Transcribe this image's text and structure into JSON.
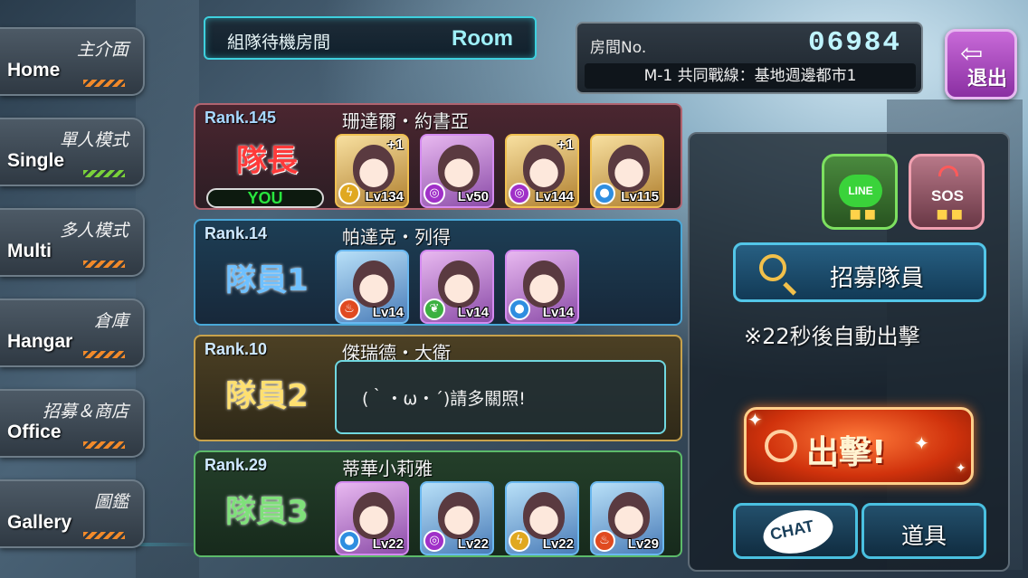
{
  "nav": [
    {
      "cn": "主介面",
      "en": "Home"
    },
    {
      "cn": "單人模式",
      "en": "Single"
    },
    {
      "cn": "多人模式",
      "en": "Multi"
    },
    {
      "cn": "倉庫",
      "en": "Hangar"
    },
    {
      "cn": "招募＆商店",
      "en": "Office"
    },
    {
      "cn": "圖鑑",
      "en": "Gallery"
    }
  ],
  "header": {
    "title_cn": "組隊待機房間",
    "title_en": "Room"
  },
  "room": {
    "label": "房間No.",
    "number": "06984",
    "stage": "M-1 共同戰線：基地週邊都市1"
  },
  "exit": {
    "label": "退出",
    "icon": "back-arrow-icon"
  },
  "members": [
    {
      "rank": "Rank.145",
      "name": "珊達爾・約書亞",
      "role": "隊長",
      "you": "YOU",
      "cards": [
        {
          "plus": "+1",
          "level": "Lv134",
          "element": "thunder-icon",
          "frame": "gold"
        },
        {
          "plus": "",
          "level": "Lv50",
          "element": "dark-icon",
          "frame": "purple"
        },
        {
          "plus": "+1",
          "level": "Lv144",
          "element": "dark-icon",
          "frame": "gold"
        },
        {
          "plus": "",
          "level": "Lv115",
          "element": "water-icon",
          "frame": "gold"
        }
      ]
    },
    {
      "rank": "Rank.14",
      "name": "帕達克・列得",
      "role": "隊員1",
      "cards": [
        {
          "plus": "",
          "level": "Lv14",
          "element": "fire-icon",
          "frame": "blue"
        },
        {
          "plus": "",
          "level": "Lv14",
          "element": "wind-icon",
          "frame": "purple"
        },
        {
          "plus": "",
          "level": "Lv14",
          "element": "water-icon",
          "frame": "purple"
        }
      ]
    },
    {
      "rank": "Rank.10",
      "name": "傑瑞德・大衛",
      "role": "隊員2",
      "chat": "(｀・ω・´)請多關照!"
    },
    {
      "rank": "Rank.29",
      "name": "蒂華小莉雅",
      "role": "隊員3",
      "cards": [
        {
          "plus": "",
          "level": "Lv22",
          "element": "water-icon",
          "frame": "purple"
        },
        {
          "plus": "",
          "level": "Lv22",
          "element": "dark-icon",
          "frame": "blue"
        },
        {
          "plus": "",
          "level": "Lv22",
          "element": "thunder-icon",
          "frame": "blue"
        },
        {
          "plus": "",
          "level": "Lv29",
          "element": "fire-icon",
          "frame": "blue"
        }
      ]
    }
  ],
  "side": {
    "line_label": "LINE",
    "sos_label": "SOS",
    "dots": "■■",
    "recruit_label": "招募隊員",
    "auto_text": "※22秒後自動出擊",
    "sortie_label": "出擊!",
    "chat_label": "CHAT",
    "item_label": "道具"
  }
}
